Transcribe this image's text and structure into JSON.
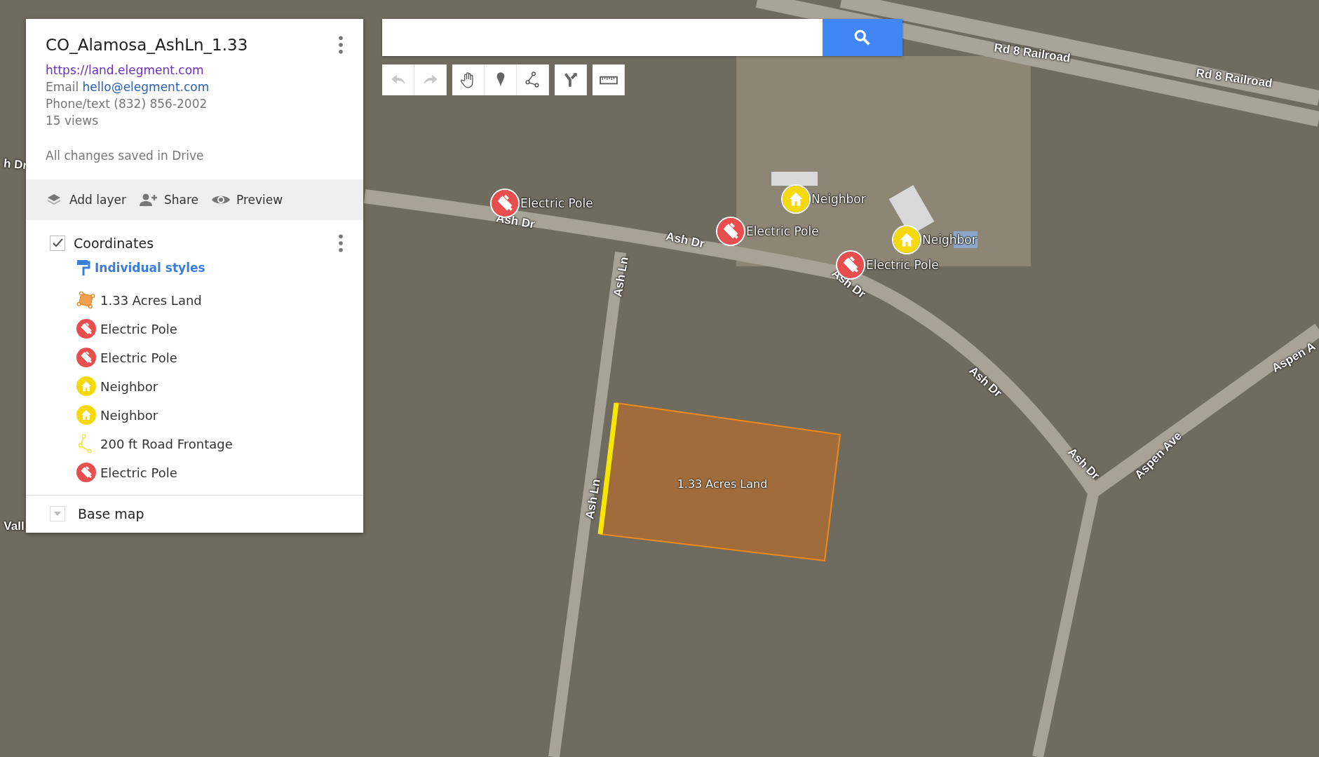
{
  "panel": {
    "title": "CO_Alamosa_AshLn_1.33",
    "website": "https://land.elegment.com",
    "email_label": "Email",
    "email": "hello@elegment.com",
    "phone": "Phone/text (832) 856-2002",
    "views": "15 views",
    "save_status": "All changes saved in Drive"
  },
  "actions": [
    {
      "kind": "layers",
      "label": "Add layer"
    },
    {
      "kind": "share",
      "label": "Share"
    },
    {
      "kind": "preview",
      "label": "Preview"
    }
  ],
  "layer": {
    "name": "Coordinates",
    "checked": true,
    "style": "Individual styles",
    "items": [
      {
        "kind": "polygon",
        "label": "1.33 Acres Land"
      },
      {
        "kind": "pole",
        "label": "Electric Pole"
      },
      {
        "kind": "pole",
        "label": "Electric Pole"
      },
      {
        "kind": "house",
        "label": "Neighbor"
      },
      {
        "kind": "house",
        "label": "Neighbor"
      },
      {
        "kind": "line",
        "label": "200 ft Road Frontage"
      },
      {
        "kind": "pole",
        "label": "Electric Pole"
      }
    ]
  },
  "base_map": {
    "label": "Base map",
    "expanded": false
  },
  "tools": [
    {
      "kind": "undo",
      "disabled": true
    },
    {
      "kind": "redo",
      "disabled": true
    },
    {
      "kind": "hand",
      "disabled": false
    },
    {
      "kind": "marker",
      "disabled": false
    },
    {
      "kind": "line",
      "disabled": false
    },
    {
      "kind": "route",
      "disabled": false
    },
    {
      "kind": "ruler",
      "disabled": false
    }
  ],
  "map_markers": [
    {
      "kind": "pole",
      "label": "Electric Pole"
    },
    {
      "kind": "house",
      "label": "Neighbor"
    },
    {
      "kind": "pole",
      "label": "Electric Pole"
    },
    {
      "kind": "pole",
      "label": "Electric Pole"
    },
    {
      "kind": "house",
      "label": "Neighbor"
    }
  ],
  "polygon_label": "1.33 Acres Land",
  "road_labels": [
    "Rd 8 Railroad",
    "Rd 8 Railroad",
    "Ash Dr",
    "Ash Dr",
    "Ash Dr",
    "Ash Dr",
    "Ash Dr",
    "Ash Ln",
    "Ash Ln",
    "Aspen Ave",
    "Aspen A",
    "h Dr",
    "Vall"
  ]
}
